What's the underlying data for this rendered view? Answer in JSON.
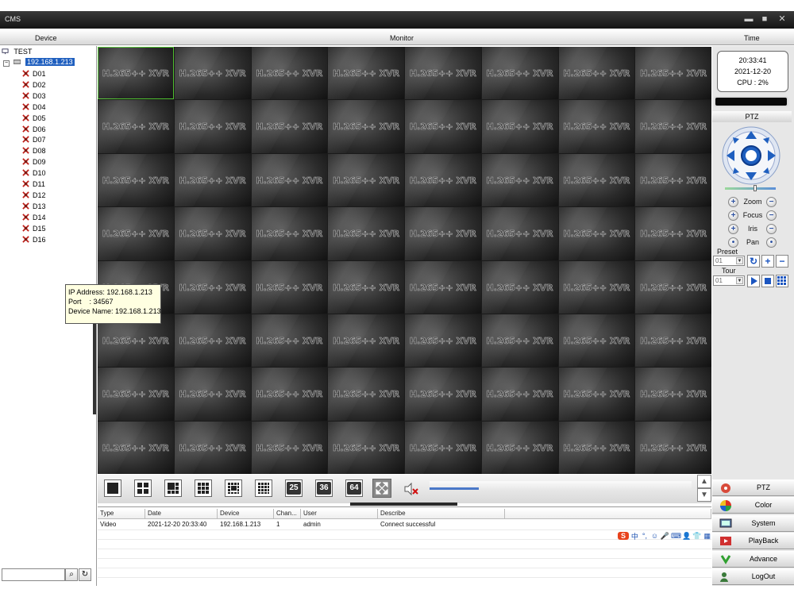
{
  "window": {
    "title": "CMS",
    "minimize": "▬",
    "maximize": "■",
    "close": "✕"
  },
  "header": {
    "device": "Device",
    "monitor": "Monitor",
    "time": "Time"
  },
  "tree": {
    "root": "TEST",
    "device": "192.168.1.213",
    "channels": [
      "D01",
      "D02",
      "D03",
      "D04",
      "D05",
      "D06",
      "D07",
      "D08",
      "D09",
      "D10",
      "D11",
      "D12",
      "D13",
      "D14",
      "D15",
      "D16"
    ]
  },
  "tooltip": {
    "ip": "IP Address: 192.168.1.213",
    "port": "Port    : 34567",
    "name": "Device Name: 192.168.1.213"
  },
  "monitor": {
    "cell_label": "H.265++ XVR",
    "columns": 8,
    "rows": 8,
    "active_cell": 0
  },
  "toolbar": {
    "split25": "25",
    "split36": "36",
    "split64": "64",
    "up": "▲",
    "down": "▼"
  },
  "log": {
    "headers": [
      "Type",
      "Date",
      "Device",
      "Chan...",
      "User",
      "Describe"
    ],
    "rows": [
      [
        "Video",
        "2021-12-20 20:33:40",
        "192.168.1.213",
        "1",
        "admin",
        "Connect successful"
      ]
    ]
  },
  "ime": [
    "S",
    "中",
    "°,",
    "☺",
    "🎤",
    "⌨",
    "👤",
    "👕",
    "▦"
  ],
  "clock": {
    "time": "20:33:41",
    "date": "2021-12-20",
    "cpu": "CPU : 2%"
  },
  "ptz": {
    "title": "PTZ",
    "rows": [
      {
        "label": "Zoom",
        "left": "+",
        "right": "−"
      },
      {
        "label": "Focus",
        "left": "+",
        "right": "−"
      },
      {
        "label": "Iris",
        "left": "+",
        "right": "−"
      },
      {
        "label": "Pan",
        "left": "•",
        "right": "•"
      }
    ],
    "preset_label": "Preset",
    "preset_value": "01",
    "tour_label": "Tour",
    "tour_value": "01"
  },
  "menu": [
    "PTZ",
    "Color",
    "System",
    "PlayBack",
    "Advance",
    "LogOut"
  ],
  "colors": {
    "selection": "#1f5fbf",
    "active_cell": "#4fbf2f",
    "accent": "#1b55c0"
  }
}
